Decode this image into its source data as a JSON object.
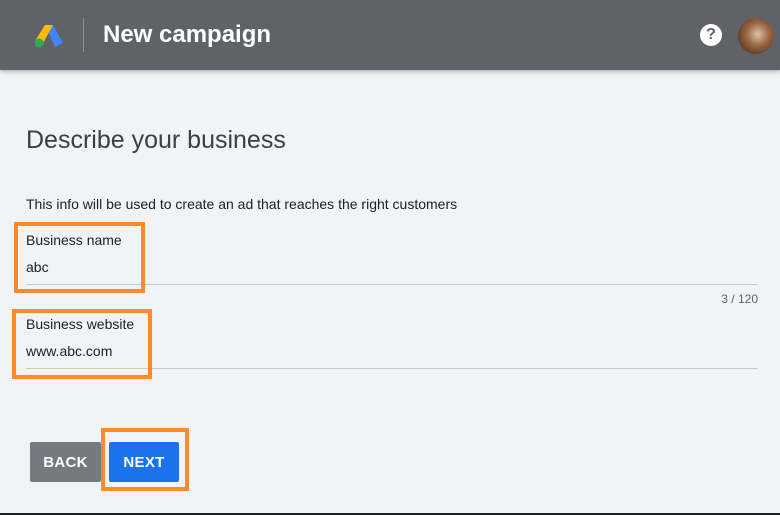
{
  "header": {
    "logo_icon": "google-ads-logo",
    "title": "New campaign",
    "help_icon": "help-icon",
    "help_glyph": "?",
    "avatar_icon": "account-avatar"
  },
  "main": {
    "heading": "Describe your business",
    "subtitle": "This info will be used to create an ad that reaches the right customers",
    "fields": [
      {
        "label": "Business name",
        "value": "abc",
        "counter": "3 / 120"
      },
      {
        "label": "Business website",
        "value": "www.abc.com"
      }
    ],
    "buttons": {
      "back": "BACK",
      "next": "NEXT"
    }
  },
  "colors": {
    "header_bg": "#5f6368",
    "page_bg": "#f1f3f4",
    "primary": "#1a73e8",
    "secondary_button": "#757a80",
    "highlight": "#ff8a2a"
  }
}
